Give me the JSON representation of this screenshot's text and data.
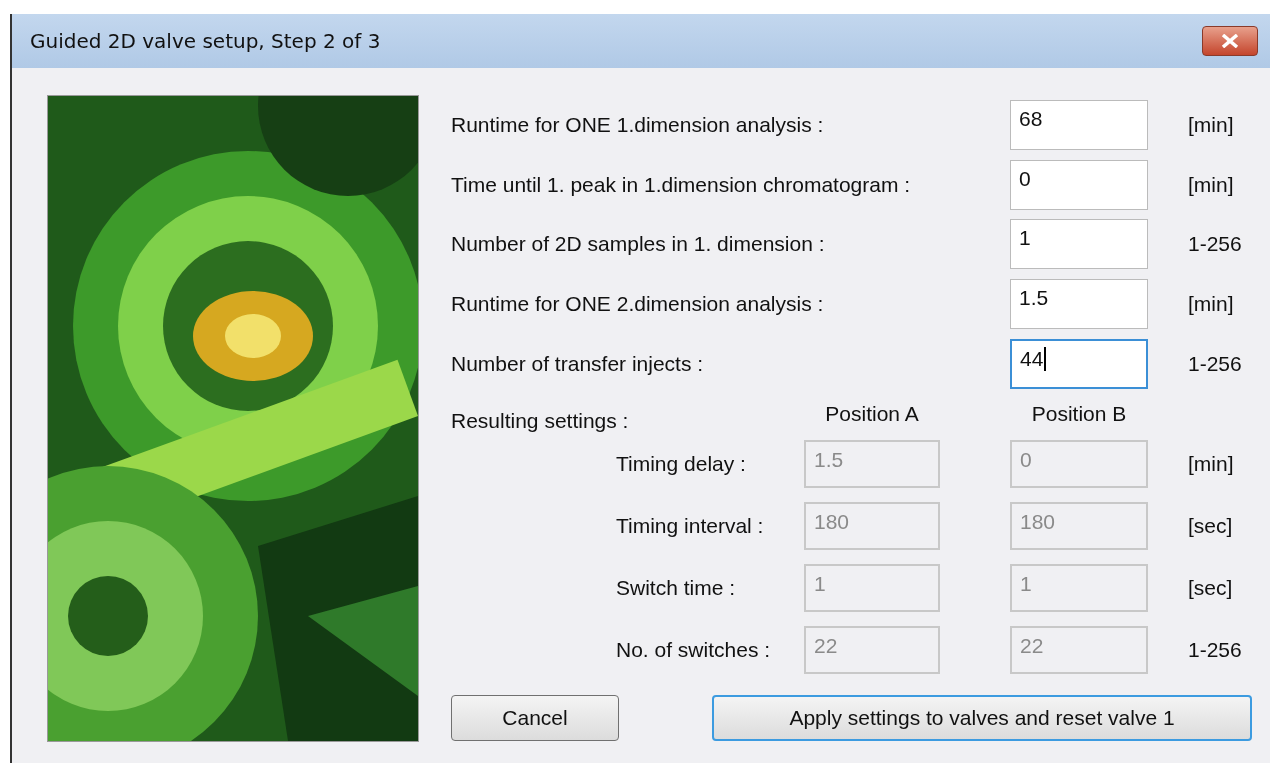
{
  "window": {
    "title": "Guided 2D valve setup, Step 2 of 3"
  },
  "inputs": [
    {
      "label": "Runtime for ONE 1.dimension analysis :",
      "value": "68",
      "unit": "[min]",
      "focused": false
    },
    {
      "label": "Time until 1. peak in 1.dimension chromatogram :",
      "value": "0",
      "unit": "[min]",
      "focused": false
    },
    {
      "label": "Number of 2D samples in 1. dimension :",
      "value": "1",
      "unit": "1-256",
      "focused": false
    },
    {
      "label": "Runtime for ONE 2.dimension analysis :",
      "value": "1.5",
      "unit": "[min]",
      "focused": false
    },
    {
      "label": "Number of transfer injects :",
      "value": "44",
      "unit": "1-256",
      "focused": true
    }
  ],
  "results": {
    "label": "Resulting settings :",
    "columns": [
      "Position A",
      "Position B"
    ],
    "rows": [
      {
        "label": "Timing delay :",
        "a": "1.5",
        "b": "0",
        "unit": "[min]",
        "disabled": true
      },
      {
        "label": "Timing interval :",
        "a": "180",
        "b": "180",
        "unit": "[sec]",
        "disabled": true
      },
      {
        "label": "Switch time :",
        "a": "1",
        "b": "1",
        "unit": "[sec]",
        "disabled": true
      },
      {
        "label": "No. of switches :",
        "a": "22",
        "b": "22",
        "unit": "1-256",
        "disabled": true
      }
    ]
  },
  "buttons": [
    {
      "label": "Cancel",
      "default": false
    },
    {
      "label": "Apply settings to valves and reset valve 1",
      "default": true
    }
  ]
}
